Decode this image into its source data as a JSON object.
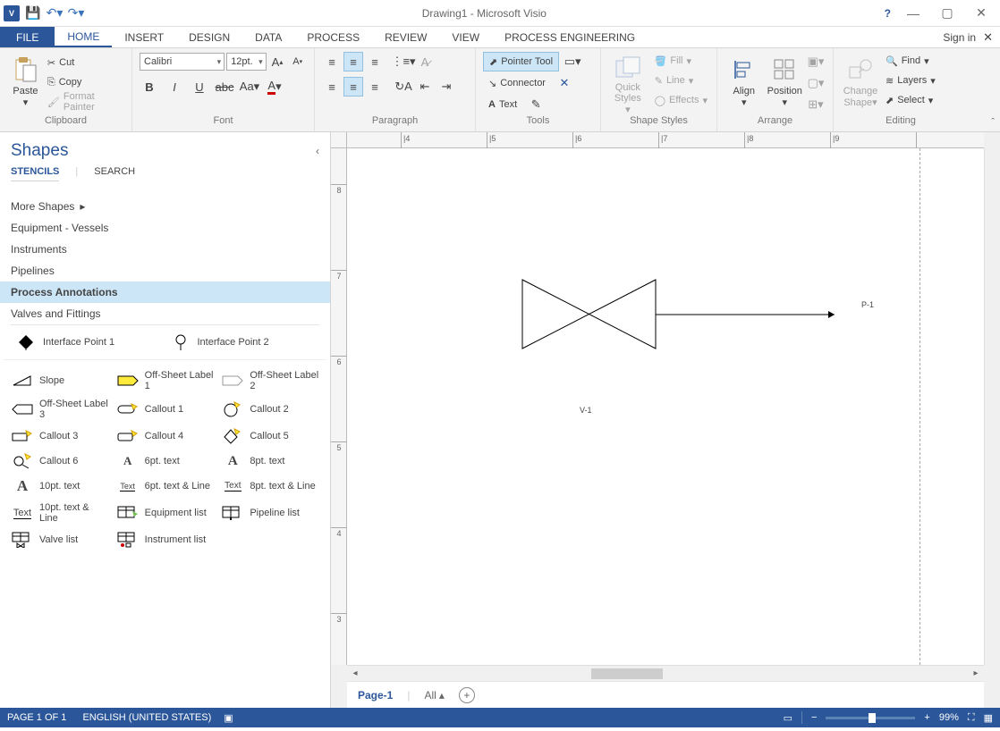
{
  "titlebar": {
    "app_title": "Drawing1 - Microsoft Visio",
    "help": "?"
  },
  "sign_in": "Sign in",
  "tabs": {
    "file": "FILE",
    "home": "HOME",
    "insert": "INSERT",
    "design": "DESIGN",
    "data": "DATA",
    "process": "PROCESS",
    "review": "REVIEW",
    "view": "VIEW",
    "proc_eng": "PROCESS ENGINEERING"
  },
  "ribbon": {
    "clipboard": {
      "label": "Clipboard",
      "paste": "Paste",
      "cut": "Cut",
      "copy": "Copy",
      "format_painter": "Format Painter"
    },
    "font": {
      "label": "Font",
      "name": "Calibri",
      "size": "12pt."
    },
    "paragraph": {
      "label": "Paragraph"
    },
    "tools": {
      "label": "Tools",
      "pointer": "Pointer Tool",
      "connector": "Connector",
      "text": "Text"
    },
    "shape_styles": {
      "label": "Shape Styles",
      "fill": "Fill",
      "line": "Line",
      "effects": "Effects",
      "quick": "Quick Styles"
    },
    "arrange": {
      "label": "Arrange",
      "align": "Align",
      "position": "Position"
    },
    "editing": {
      "label": "Editing",
      "change_shape": "Change Shape",
      "find": "Find",
      "layers": "Layers",
      "select": "Select"
    }
  },
  "shapes_pane": {
    "title": "Shapes",
    "stencils": "STENCILS",
    "search": "SEARCH",
    "more_shapes": "More Shapes",
    "categories": [
      "Equipment - Vessels",
      "Instruments",
      "Pipelines",
      "Process Annotations",
      "Valves and Fittings"
    ],
    "top_items": [
      "Interface Point 1",
      "Interface Point 2"
    ],
    "items": [
      "Slope",
      "Off-Sheet Label 1",
      "Off-Sheet Label 2",
      "Off-Sheet Label 3",
      "Callout 1",
      "Callout 2",
      "Callout 3",
      "Callout 4",
      "Callout 5",
      "Callout 6",
      "6pt. text",
      "8pt. text",
      "10pt. text",
      "6pt. text & Line",
      "8pt. text & Line",
      "10pt. text & Line",
      "Equipment list",
      "Pipeline list",
      "Valve list",
      "Instrument list"
    ]
  },
  "canvas": {
    "ruler_h": [
      "|4",
      "|5",
      "|6",
      "|7",
      "|8",
      "|9"
    ],
    "ruler_v": [
      "8",
      "7",
      "6",
      "5",
      "4",
      "3"
    ],
    "labels": {
      "v1": "V-1",
      "p1": "P-1"
    }
  },
  "page_tabs": {
    "page1": "Page-1",
    "all": "All"
  },
  "statusbar": {
    "page": "PAGE 1 OF 1",
    "lang": "ENGLISH (UNITED STATES)",
    "zoom": "99%"
  }
}
